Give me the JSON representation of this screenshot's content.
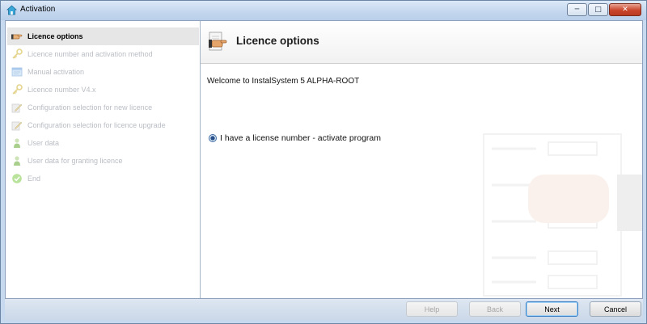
{
  "window": {
    "title": "Activation",
    "minimize_glyph": "─",
    "maximize_glyph": "□",
    "close_glyph": "✕"
  },
  "sidebar": {
    "items": [
      {
        "label": "Licence options",
        "icon": "hand-pointer-icon",
        "state": "active"
      },
      {
        "label": "Licence number and activation method",
        "icon": "key-icon",
        "state": "disabled"
      },
      {
        "label": "Manual activation",
        "icon": "form-icon",
        "state": "disabled"
      },
      {
        "label": "Licence number V4.x",
        "icon": "key-icon",
        "state": "disabled"
      },
      {
        "label": "Configuration selection for new licence",
        "icon": "edit-icon",
        "state": "disabled"
      },
      {
        "label": "Configuration selection for licence upgrade",
        "icon": "edit-icon",
        "state": "disabled"
      },
      {
        "label": "User data",
        "icon": "user-icon",
        "state": "disabled"
      },
      {
        "label": "User data for granting licence",
        "icon": "user-icon",
        "state": "disabled"
      },
      {
        "label": "End",
        "icon": "check-icon",
        "state": "disabled"
      }
    ]
  },
  "main": {
    "title": "Licence options",
    "welcome_text": "Welcome to InstalSystem 5 ALPHA-ROOT",
    "option_label": "I have a license number - activate program",
    "option_selected": true
  },
  "footer": {
    "help_label": "Help",
    "back_label": "Back",
    "next_label": "Next",
    "cancel_label": "Cancel"
  },
  "colors": {
    "accent": "#3b7fc4",
    "disabled_text": "#b9bdc4",
    "active_item_bg": "#e6e6e6"
  }
}
